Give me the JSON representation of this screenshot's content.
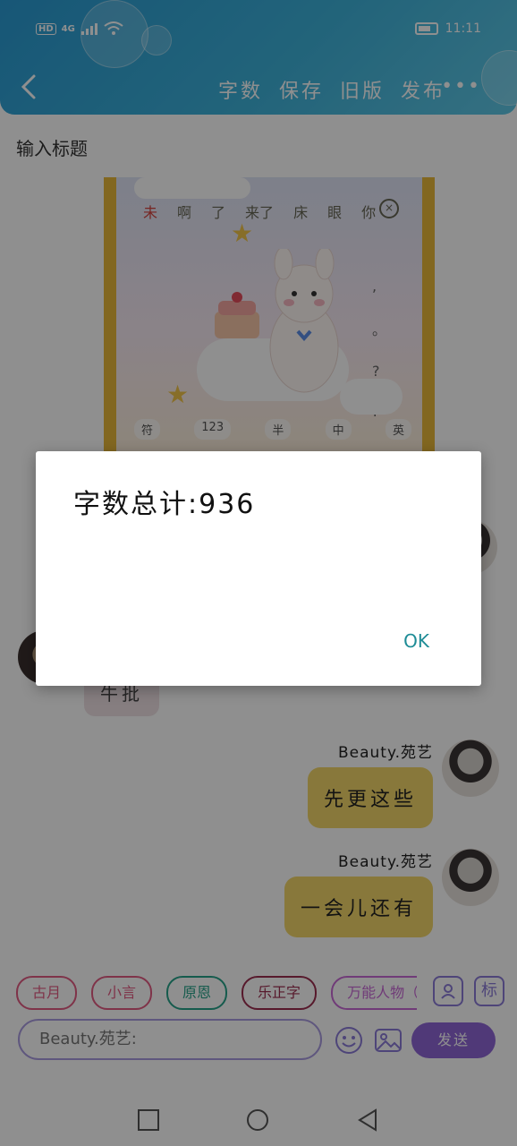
{
  "status_bar": {
    "network": "HD",
    "signal_label": "4G",
    "time": "11:11"
  },
  "header": {
    "menu": [
      "字数",
      "保存",
      "旧版",
      "发布"
    ],
    "more": "•••"
  },
  "editor": {
    "title_placeholder": "输入标题"
  },
  "sticker_keyboard": {
    "top_row": [
      "未",
      "啊",
      "了",
      "来了",
      "床",
      "眼",
      "你"
    ],
    "punctuation": [
      ",",
      "。",
      "?",
      "!"
    ],
    "bottom_row": [
      "符",
      "123",
      "半",
      "中",
      "英"
    ]
  },
  "chat": {
    "left_bubble": "牛批",
    "messages": [
      {
        "name": "Beauty.苑艺",
        "text": "先更这些"
      },
      {
        "name": "Beauty.苑艺",
        "text": "一会儿还有"
      }
    ]
  },
  "composer": {
    "tags": [
      "古月",
      "小言",
      "原恩",
      "乐正字",
      "万能人物（请"
    ],
    "input_text": "Beauty.苑艺:",
    "send_label": "发送",
    "tag_icon_label": "标"
  },
  "dialog": {
    "message": "字数总计:936",
    "ok_label": "OK"
  },
  "colors": {
    "header": "#2a9bd4",
    "bubble": "#f3d66a",
    "send": "#8f67d6",
    "ok": "#1e8c96"
  }
}
